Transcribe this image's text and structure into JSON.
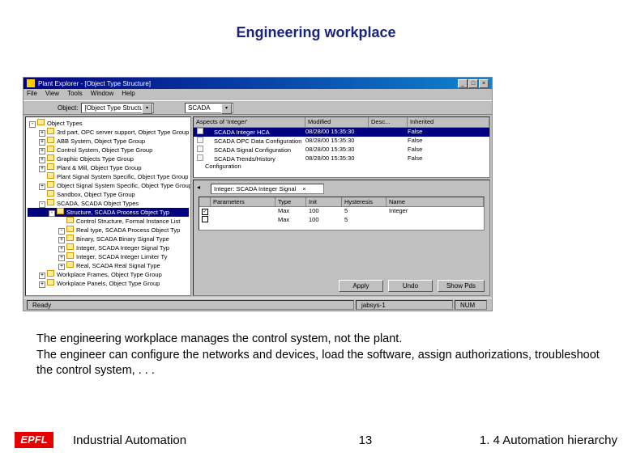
{
  "slide": {
    "title": "Engineering workplace",
    "description": "The engineering workplace manages the control system, not the plant.\nThe engineer can configure the networks and devices, load the software, assign authorizations, troubleshoot the control system, . . .",
    "footer_left": "Industrial Automation",
    "footer_page": "13",
    "footer_right": "1. 4 Automation hierarchy",
    "logo": "EPFL"
  },
  "window": {
    "title": "Plant Explorer - [Object Type Structure]",
    "menu": [
      "File",
      "View",
      "Tools",
      "Window",
      "Help"
    ],
    "toolbar": {
      "label_object": "Object:",
      "combo_structure": "[Object Type Structure]",
      "combo_right": "SCADA"
    },
    "status": {
      "left": "Ready",
      "center": "jabsys-1",
      "right": "NUM"
    }
  },
  "tree": [
    {
      "lvl": 0,
      "exp": "-",
      "label": "Object Types"
    },
    {
      "lvl": 1,
      "exp": "+",
      "label": "3rd part, OPC server support, Object Type Group"
    },
    {
      "lvl": 1,
      "exp": "+",
      "label": "ABB System, Object Type Group"
    },
    {
      "lvl": 1,
      "exp": "+",
      "label": "Control System, Object Type Group"
    },
    {
      "lvl": 1,
      "exp": "+",
      "label": "Graphic Objects Type Group"
    },
    {
      "lvl": 1,
      "exp": "+",
      "label": "Plant & Mill, Object Type Group"
    },
    {
      "lvl": 1,
      "exp": "",
      "label": "Plant Signal System Specific, Object Type Group"
    },
    {
      "lvl": 1,
      "exp": "+",
      "label": "Object Signal System Specific, Object Type Group"
    },
    {
      "lvl": 1,
      "exp": "",
      "label": "Sandbox, Object Type Group"
    },
    {
      "lvl": 1,
      "exp": "-",
      "label": "SCADA, SCADA Object Types"
    },
    {
      "lvl": 2,
      "exp": "-",
      "label": "Structure, SCADA Process Object Typ",
      "sel": true
    },
    {
      "lvl": 3,
      "exp": "",
      "label": "Control Structure, Formal Instance List"
    },
    {
      "lvl": 3,
      "exp": "-",
      "label": "Real type, SCADA Process Object Typ"
    },
    {
      "lvl": 3,
      "exp": "+",
      "label": "Binary, SCADA Binary Signal Type"
    },
    {
      "lvl": 3,
      "exp": "+",
      "label": "Integer, SCADA Integer Signal Typ"
    },
    {
      "lvl": 3,
      "exp": "+",
      "label": "Integer, SCADA Integer Limiter Ty"
    },
    {
      "lvl": 3,
      "exp": "+",
      "label": "Real, SCADA Real Signal Type"
    },
    {
      "lvl": 1,
      "exp": "+",
      "label": "Workplace Frames, Object Type Group"
    },
    {
      "lvl": 1,
      "exp": "+",
      "label": "Workplace Panels, Object Type Group"
    }
  ],
  "list": {
    "cols": [
      "Aspects of 'Integer'",
      "Modified",
      "Desc...",
      "Inherited"
    ],
    "rows": [
      {
        "c1": "SCADA Integer HCA",
        "c2": "08/28/00 15:35:30",
        "c3": "",
        "c4": "False",
        "sel": true
      },
      {
        "c1": "SCADA OPC Data Configuration",
        "c2": "08/28/00 15:35:30",
        "c3": "",
        "c4": "False"
      },
      {
        "c1": "SCADA Signal Configuration",
        "c2": "08/28/00 15:35:30",
        "c3": "",
        "c4": "False"
      },
      {
        "c1": "SCADA Trends/History Configuration",
        "c2": "08/28/00 15:35:30",
        "c3": "",
        "c4": "False"
      }
    ]
  },
  "props": {
    "tab": "Integer: SCADA Integer Signal",
    "cols": [
      "",
      "Parameters",
      "Type",
      "Init",
      "Hysteresis",
      "Name"
    ],
    "rows": [
      {
        "chk": "✓",
        "p": "",
        "t": "Max",
        "i": "100",
        "h": "5",
        "n": "Integer"
      },
      {
        "chk": "",
        "p": "",
        "t": "Max",
        "i": "100",
        "h": "5",
        "n": ""
      }
    ],
    "buttons": {
      "apply": "Apply",
      "undo": "Undo",
      "showpds": "Show Pds"
    }
  }
}
